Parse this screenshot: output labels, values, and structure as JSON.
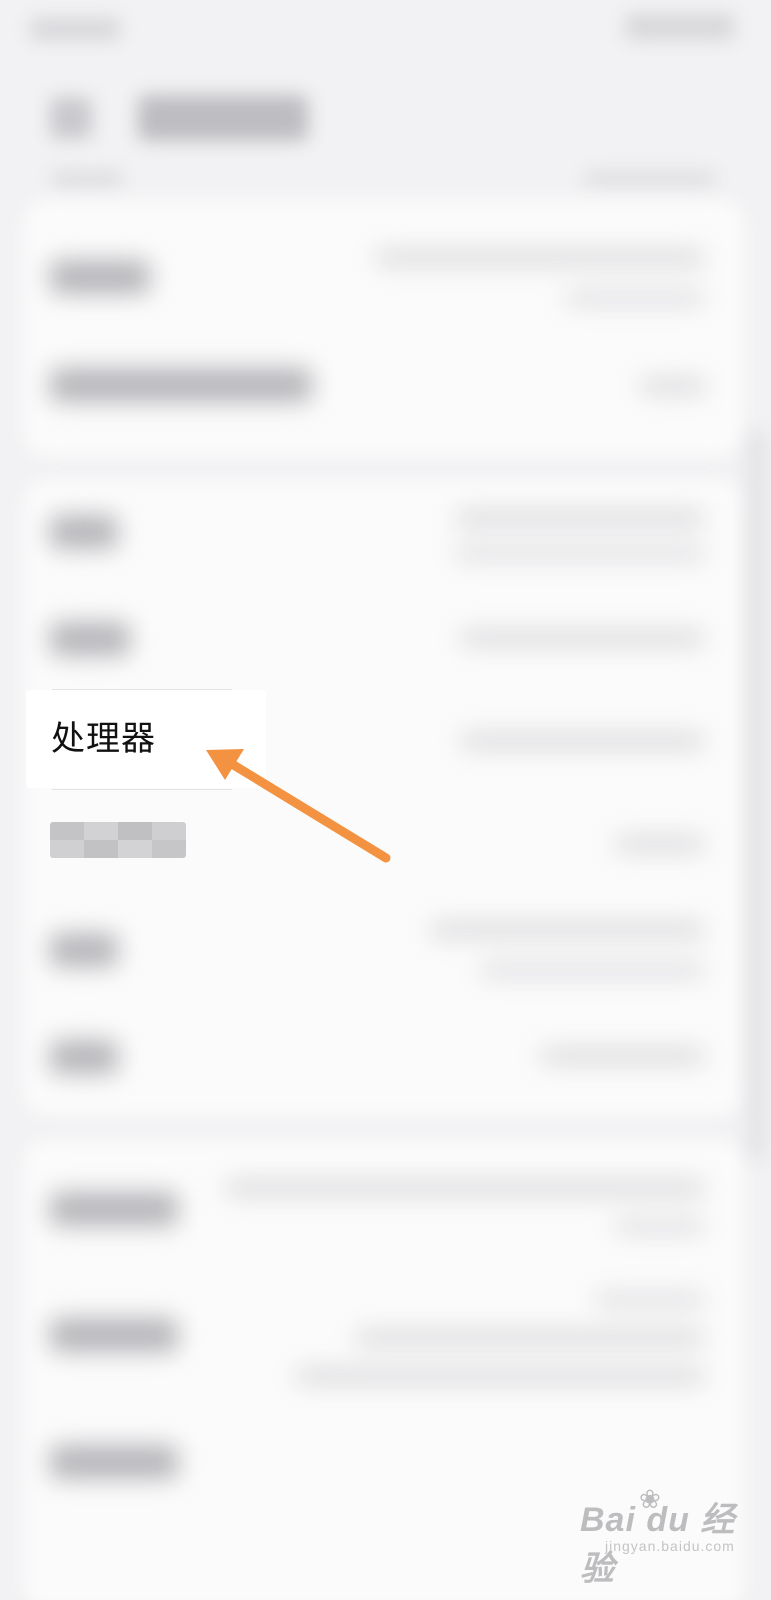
{
  "highlighted_item": {
    "label": "处理器"
  },
  "watermark": {
    "brand": "Bai du 经验",
    "paw": "❀",
    "url": "jingyan.baidu.com"
  },
  "colors": {
    "arrow": "#f39241",
    "background": "#f2f2f4",
    "card": "#fbfbfb",
    "label_text": "#111111"
  },
  "icons": {
    "back": "back-arrow-icon",
    "pointer": "pointer-arrow-icon"
  }
}
